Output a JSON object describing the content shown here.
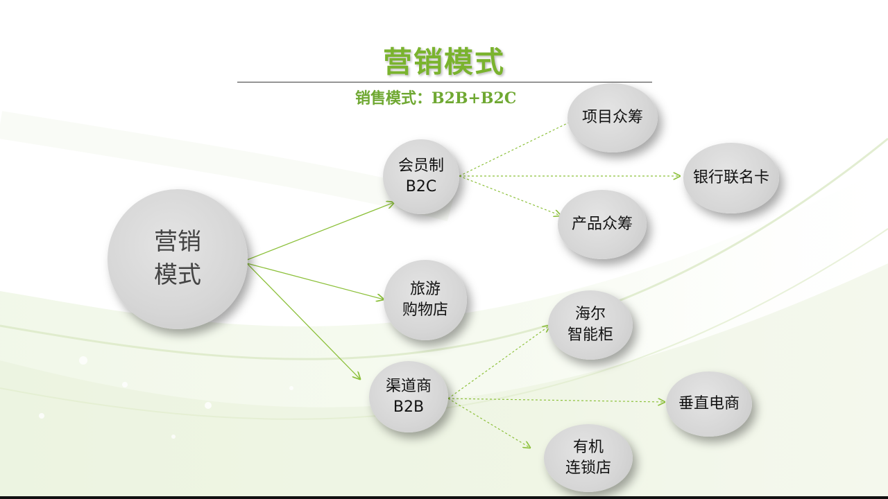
{
  "slide": {
    "title": "营销模式",
    "subtitle": "销售模式：B2B+B2C"
  },
  "nodes": {
    "root": "营销\n模式",
    "membership": "会员制\nB2C",
    "travel": "旅游\n购物店",
    "channel": "渠道商\nB2B",
    "project_crowdfunding": "项目众筹",
    "bank_card": "银行联名卡",
    "product_crowdfunding": "产品众筹",
    "haier_cabinet": "海尔\n智能柜",
    "vertical_ecommerce": "垂直电商",
    "organic_chain": "有机\n连锁店"
  },
  "colors": {
    "title": "#7ab32e",
    "subtitle": "#6fa832",
    "solid_link": "#8cc03a",
    "dashed_link": "#8cc03a",
    "node_fill": "#d6d6d6"
  }
}
